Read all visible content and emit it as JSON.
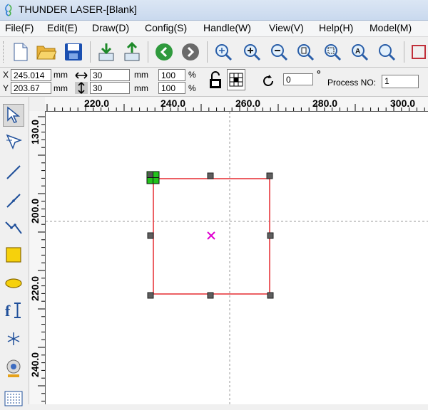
{
  "window": {
    "title": "THUNDER LASER-[Blank]"
  },
  "menu": [
    "File(F)",
    "Edit(E)",
    "Draw(D)",
    "Config(S)",
    "Handle(W)",
    "View(V)",
    "Help(H)",
    "Model(M)"
  ],
  "toolbar": {
    "icons": [
      "new-file-icon",
      "open-folder-icon",
      "save-icon",
      "import-icon",
      "export-icon",
      "back-icon",
      "forward-icon",
      "zoom-fit-icon",
      "zoom-in-icon",
      "zoom-out-icon",
      "zoom-page-icon",
      "zoom-select-icon",
      "zoom-all-icon",
      "search-icon"
    ]
  },
  "properties": {
    "x_label": "X",
    "x_value": "245.014",
    "x_unit": "mm",
    "y_label": "Y",
    "y_value": "203.67",
    "y_unit": "mm",
    "width_value": "30",
    "width_unit": "mm",
    "height_value": "30",
    "height_unit": "mm",
    "scale_w_value": "100",
    "scale_w_unit": "%",
    "scale_h_value": "100",
    "scale_h_unit": "%",
    "rotation_value": "0",
    "rotation_unit": "°",
    "process_label": "Process NO:",
    "process_value": "1"
  },
  "left_tools": [
    "select-tool",
    "node-edit-tool",
    "line-tool",
    "polyline-tool",
    "curve-tool",
    "rectangle-tool",
    "ellipse-tool",
    "text-tool",
    "point-tool",
    "camera-tool",
    "grid-tool"
  ],
  "rulers": {
    "horizontal_labels": [
      "220.0",
      "240.0",
      "260.0",
      "280.0",
      "300.0"
    ],
    "vertical_labels": [
      "130.0",
      "200.0",
      "220.0",
      "240.0"
    ]
  },
  "colors": {
    "shape_outline": "#e8383d",
    "handle": "#606060",
    "origin_handle": "#22c31b",
    "center_mark": "#e000d0",
    "guide": "#9a9a9a"
  }
}
